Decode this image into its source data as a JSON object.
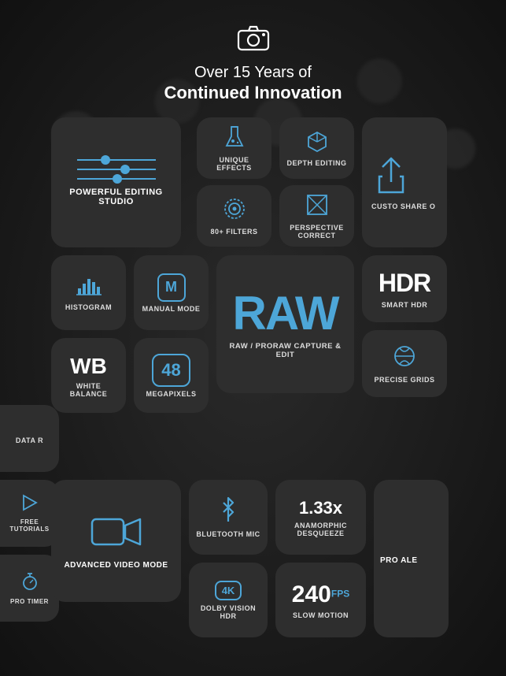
{
  "header": {
    "camera_icon": "📷",
    "subtitle": "Over 15 Years of",
    "title": "Continued Innovation"
  },
  "tiles": {
    "editing": {
      "label": "POWERFUL\nEDITING STUDIO"
    },
    "effects": {
      "label": "UNIQUE\nEFFECTS"
    },
    "depth": {
      "label": "DEPTH\nEDITING"
    },
    "share": {
      "label": "CUSTO\nSHARE O"
    },
    "filters": {
      "label": "80+ FILTERS"
    },
    "perspective": {
      "label": "PERSPECTIVE\nCORRECT"
    },
    "histogram": {
      "label": "HISTOGRAM"
    },
    "manual": {
      "label": "MANUAL MODE",
      "letter": "M"
    },
    "raw": {
      "big": "RAW",
      "label": "RAW / PRORAW\nCAPTURE & EDIT"
    },
    "hdr": {
      "big": "HDR",
      "label": "SMART HDR"
    },
    "wb": {
      "big": "WB",
      "label": "WHITE\nBALANCE"
    },
    "megapixels": {
      "big": "48",
      "label": "MEGAPIXELS"
    },
    "grids": {
      "label": "PRECISE\nGRIDS"
    },
    "data": {
      "label": "DATA\nR"
    },
    "free_tutorials": {
      "label": "FREE\nTUTORIALS"
    },
    "pro_timer": {
      "label": "PRO TIMER"
    },
    "video": {
      "label": "ADVANCED\nVIDEO MODE"
    },
    "bluetooth": {
      "label": "BLUETOOTH\nMIC"
    },
    "anamorphic": {
      "big": "1.33x",
      "label": "ANAMORPHIC\nDESQUEEZE"
    },
    "pro_alert": {
      "label": "PRO\nALE"
    },
    "dolby": {
      "label": "DOLBY VISION\nHDR",
      "sub": "4K"
    },
    "slowmo": {
      "big": "240",
      "fps": "FPS",
      "label": "SLOW MOTION"
    }
  },
  "colors": {
    "accent": "#4da6d8",
    "bg": "#1e1e1e",
    "tile_bg": "#2e2e2e"
  }
}
